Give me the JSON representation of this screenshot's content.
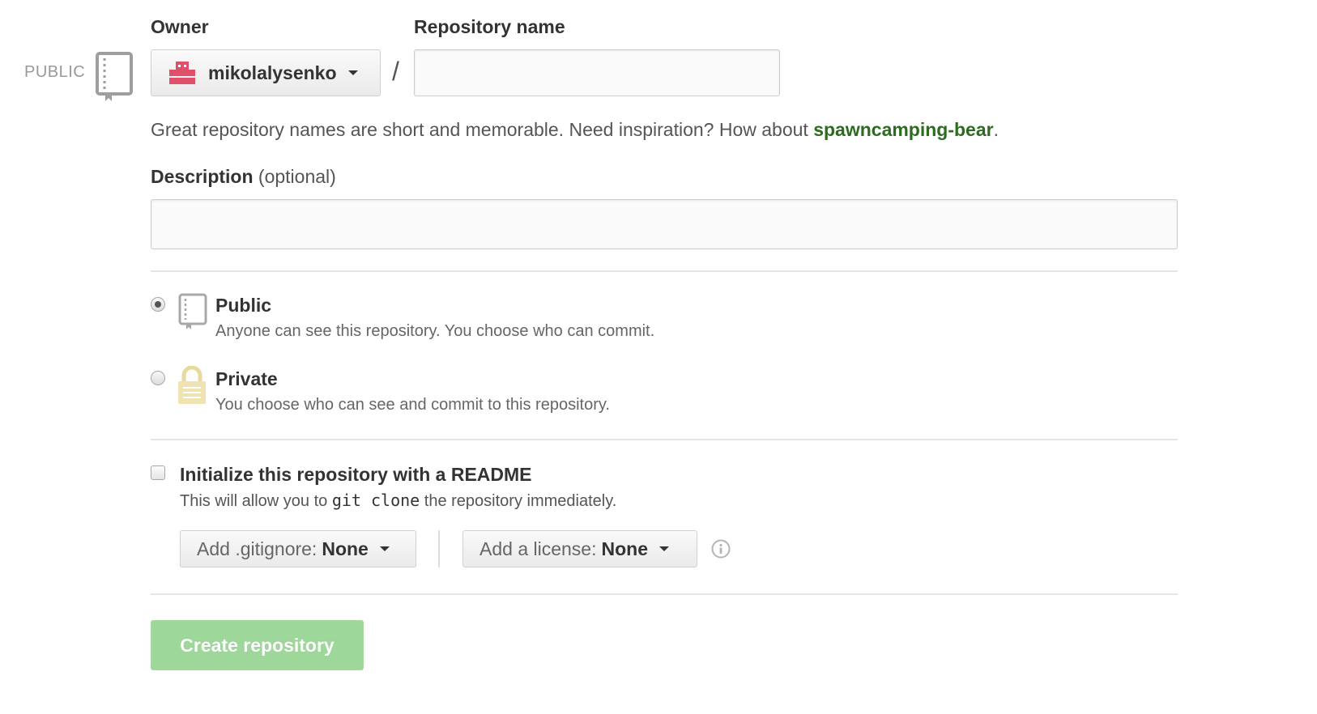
{
  "badge": {
    "text": "PUBLIC",
    "icon": "repo-book-icon"
  },
  "owner": {
    "label": "Owner",
    "selected": "mikolalysenko",
    "avatar_color": "#e0506a"
  },
  "repository_name": {
    "label": "Repository name",
    "separator": "/",
    "value": ""
  },
  "hint": {
    "text": "Great repository names are short and memorable. Need inspiration? How about ",
    "suggestion": "spawncamping-bear",
    "suffix": "."
  },
  "description": {
    "label": "Description",
    "optional_label": "(optional)",
    "value": ""
  },
  "visibility": {
    "selected": "public",
    "options": [
      {
        "id": "public",
        "title": "Public",
        "description": "Anyone can see this repository. You choose who can commit.",
        "icon": "repo-book-icon"
      },
      {
        "id": "private",
        "title": "Private",
        "description": "You choose who can see and commit to this repository.",
        "icon": "lock-icon"
      }
    ]
  },
  "readme": {
    "checked": false,
    "title": "Initialize this repository with a README",
    "desc_prefix": "This will allow you to ",
    "desc_code": "git clone",
    "desc_suffix": " the repository immediately."
  },
  "gitignore": {
    "prefix": "Add .gitignore:",
    "value": "None"
  },
  "license": {
    "prefix": "Add a license:",
    "value": "None"
  },
  "info_icon": "info-icon",
  "create_button": {
    "label": "Create repository",
    "color": "#9ed79a"
  }
}
